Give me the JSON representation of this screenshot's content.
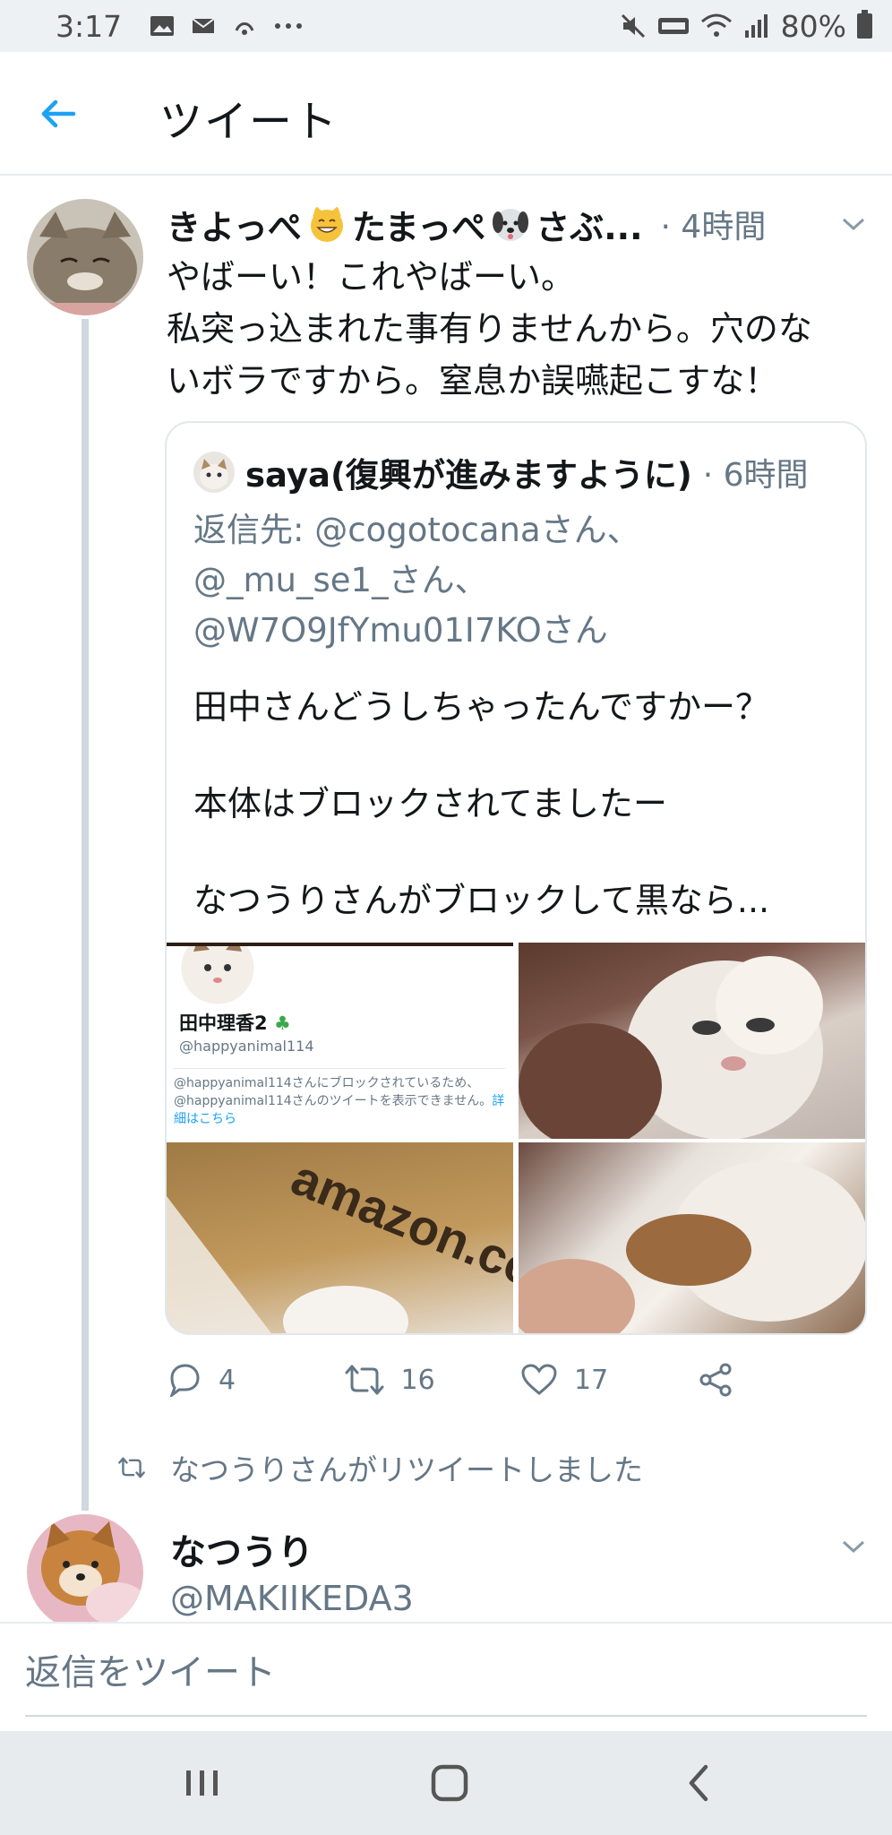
{
  "status_bar": {
    "time": "3:17",
    "battery": "80%"
  },
  "header": {
    "title": "ツイート"
  },
  "tweet": {
    "author_name": "きよっぺ",
    "author_name_part2": "たまっぺ",
    "author_name_part3": "さぶ...",
    "time": "· 4時間",
    "text": [
      "やばーい！これやばーい。",
      "私突っ込まれた事有りませんから。穴のな",
      "いボラですから。窒息か誤嚥起こすな！"
    ]
  },
  "quote": {
    "author_name": "saya(復興が進みますように)",
    "time": "· 6時間",
    "reply_prefix": "返信先: ",
    "mentions": [
      "@cogotocanaさん、",
      "@_mu_se1_さん、",
      "@W7O9JfYmu01I7KOさん"
    ],
    "paragraphs": [
      "田中さんどうしちゃったんですかー？",
      "本体はブロックされてましたー",
      "なつうりさんがブロックして黒なら..."
    ],
    "image1": {
      "profile_name": "田中理香2",
      "profile_handle": "@happyanimal114",
      "blocked_message": "@happyanimal114さんにブロックされているため、@happyanimal114さんのツイートを表示できません。",
      "link": "詳細はこちら"
    },
    "image3_text": "amazon.co.jp"
  },
  "actions": {
    "replies": "4",
    "retweets": "16",
    "likes": "17"
  },
  "retweet_notice": "なつうりさんがリツイートしました",
  "next_tweet": {
    "author_name": "なつうり",
    "handle": "@MAKIIKEDA3"
  },
  "reply_bar": {
    "placeholder": "返信をツイート"
  },
  "colors": {
    "accent": "#1da1f2",
    "secondary_text": "#657786",
    "primary_text": "#14171a"
  }
}
